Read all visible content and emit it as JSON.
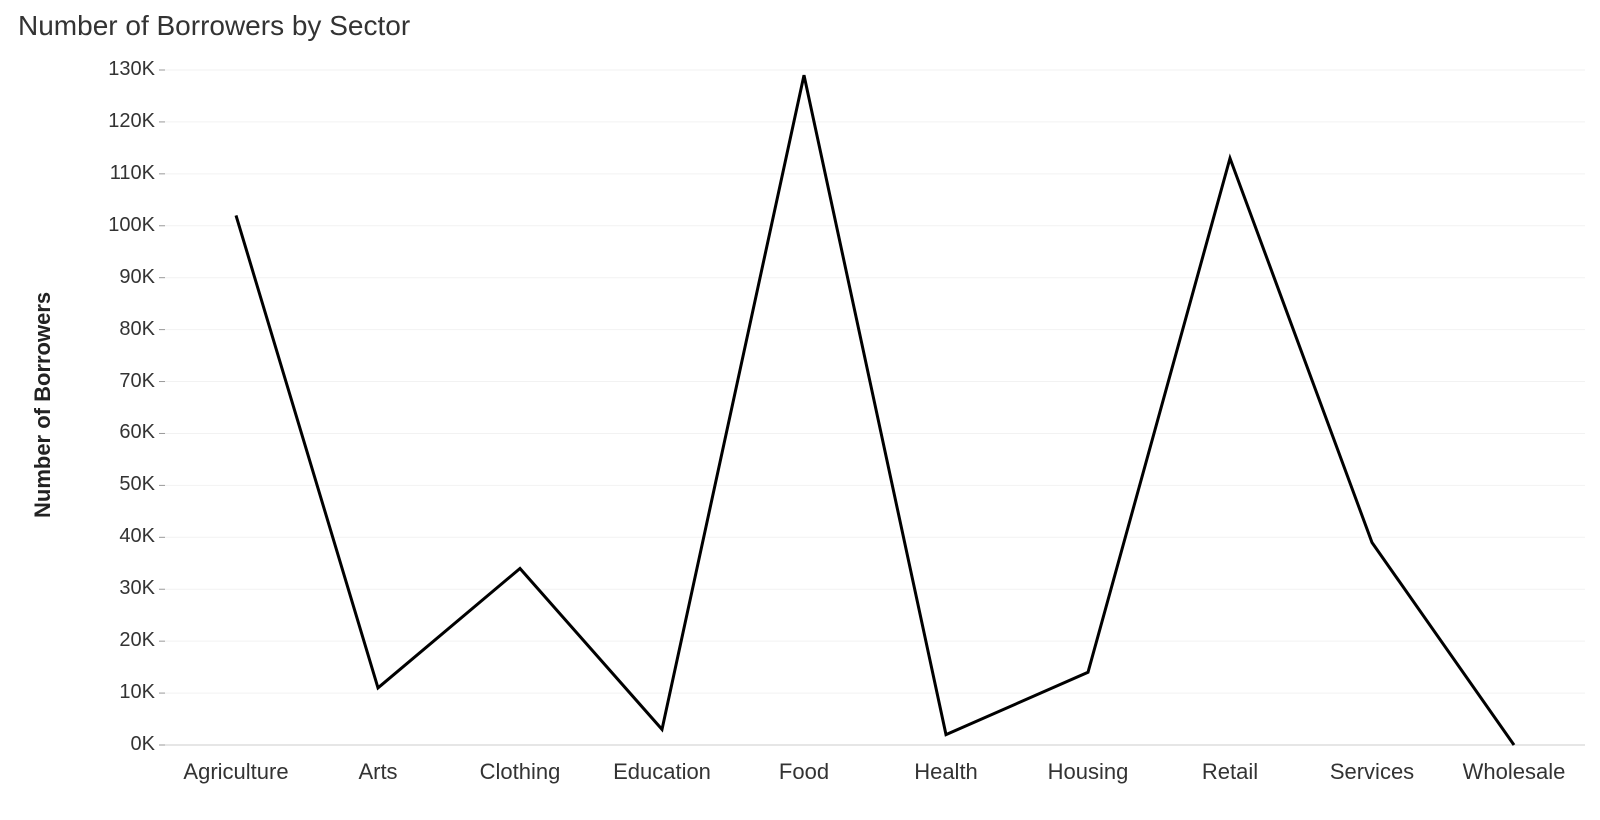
{
  "chart_data": {
    "type": "line",
    "title": "Number of Borrowers by Sector",
    "xlabel": "",
    "ylabel": "Number of Borrowers",
    "categories": [
      "Agriculture",
      "Arts",
      "Clothing",
      "Education",
      "Food",
      "Health",
      "Housing",
      "Retail",
      "Services",
      "Wholesale"
    ],
    "values": [
      102000,
      11000,
      34000,
      3000,
      129000,
      2000,
      14000,
      113000,
      39000,
      0
    ],
    "ylim": [
      0,
      130000
    ],
    "yticks": [
      0,
      10000,
      20000,
      30000,
      40000,
      50000,
      60000,
      70000,
      80000,
      90000,
      100000,
      110000,
      120000,
      130000
    ],
    "ytick_labels": [
      "0K",
      "10K",
      "20K",
      "30K",
      "40K",
      "50K",
      "60K",
      "70K",
      "80K",
      "90K",
      "100K",
      "110K",
      "120K",
      "130K"
    ],
    "grid": true,
    "line_color": "#000000",
    "grid_color": "#f2f2f2"
  }
}
